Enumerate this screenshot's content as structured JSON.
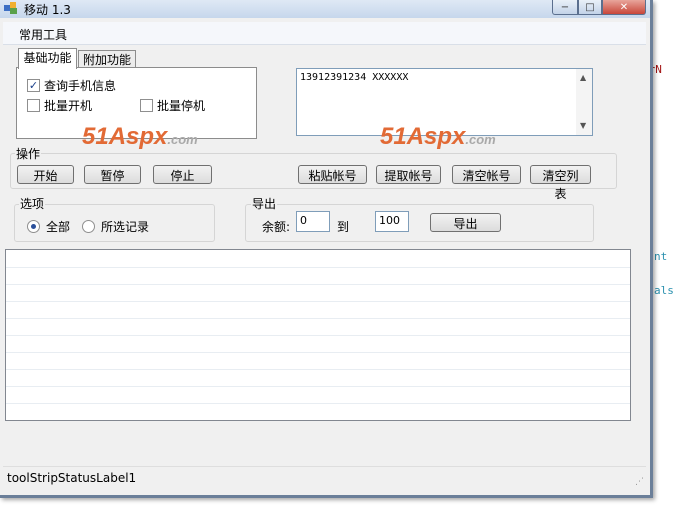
{
  "window": {
    "title": "移动 1.3",
    "minimize_glyph": "−",
    "maximize_glyph": "□",
    "close_glyph": "✕"
  },
  "menu": {
    "tools": "常用工具"
  },
  "tabs": [
    {
      "label": "基础功能",
      "active": true
    },
    {
      "label": "附加功能",
      "active": false
    }
  ],
  "basic_options": {
    "query_info": {
      "label": "查询手机信息",
      "checked": true
    },
    "batch_activate": {
      "label": "批量开机",
      "checked": false
    },
    "batch_suspend": {
      "label": "批量停机",
      "checked": false
    }
  },
  "memo": {
    "value": "13912391234 XXXXXX"
  },
  "watermark": {
    "number": "51",
    "brand": "Aspx",
    "suffix": ".com"
  },
  "operations": {
    "group_label": "操作",
    "start": "开始",
    "pause": "暂停",
    "stop": "停止",
    "paste_accounts": "粘贴帐号",
    "extract_accounts": "提取帐号",
    "clear_accounts": "清空帐号",
    "clear_list": "清空列表"
  },
  "options": {
    "group_label": "选项",
    "all": {
      "label": "全部",
      "selected": true
    },
    "selected_records": {
      "label": "所选记录",
      "selected": false
    }
  },
  "export": {
    "group_label": "导出",
    "balance_label": "余额:",
    "from_value": "0",
    "to_label": "到",
    "to_value": "100",
    "export_button": "导出"
  },
  "status_bar": {
    "label": "toolStripStatusLabel1",
    "grip_glyph": "⋰"
  },
  "background_code": {
    "frag1": "erN",
    "frag2": "nt",
    "frag3": "als"
  },
  "colors": {
    "watermark_number": "#e26a35",
    "watermark_suffix": "#a9a9a9",
    "code_text": "#a31515"
  }
}
